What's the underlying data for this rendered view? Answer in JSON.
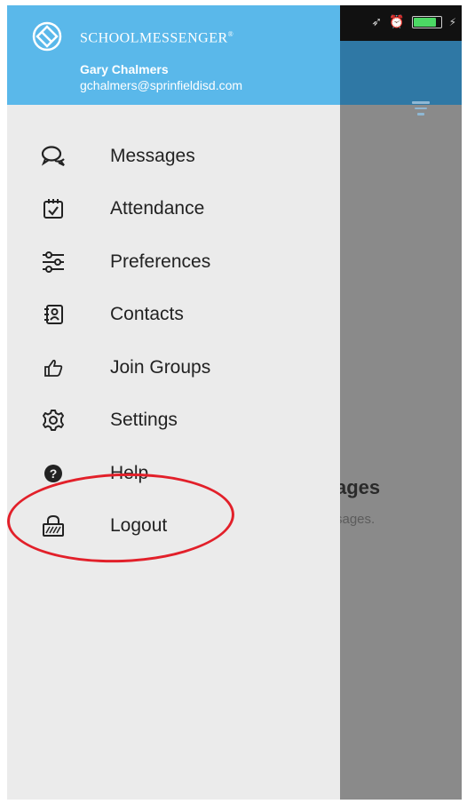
{
  "status_bar": {
    "icons": [
      "location-arrow-icon",
      "alarm-icon",
      "battery-icon",
      "charging-bolt-icon"
    ],
    "battery_level": 0.85
  },
  "background_screen": {
    "empty_title": "ages",
    "empty_subtitle": "sages."
  },
  "drawer": {
    "brand": "SchoolMessenger",
    "brand_mark": "®",
    "user": {
      "name": "Gary Chalmers",
      "email": "gchalmers@sprinfieldisd.com"
    },
    "items": [
      {
        "label": "Messages",
        "icon": "chat-bubbles-icon"
      },
      {
        "label": "Attendance",
        "icon": "calendar-check-icon"
      },
      {
        "label": "Preferences",
        "icon": "sliders-icon"
      },
      {
        "label": "Contacts",
        "icon": "address-book-icon"
      },
      {
        "label": "Join Groups",
        "icon": "thumbs-up-icon"
      },
      {
        "label": "Settings",
        "icon": "gear-icon"
      },
      {
        "label": "Help",
        "icon": "help-circle-icon"
      },
      {
        "label": "Logout",
        "icon": "lock-icon"
      }
    ]
  },
  "colors": {
    "drawer_header": "#5ab8ea",
    "app_header": "#2f78a5",
    "annotation": "#e2202a"
  }
}
